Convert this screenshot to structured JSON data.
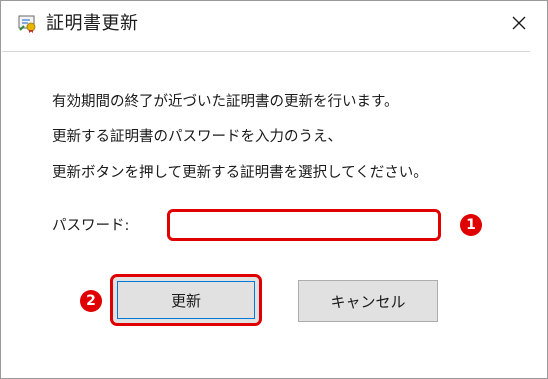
{
  "window": {
    "title": "証明書更新",
    "app_icon": "certificate-icon",
    "close_icon": "close-icon"
  },
  "message": {
    "line1": "有効期間の終了が近づいた証明書の更新を行います。",
    "line2": "更新する証明書のパスワードを入力のうえ、",
    "line3": "更新ボタンを押して更新する証明書を選択してください。"
  },
  "password": {
    "label": "パスワード:",
    "value": "",
    "placeholder": ""
  },
  "markers": {
    "m1": "1",
    "m2": "2"
  },
  "buttons": {
    "update_label": "更新",
    "cancel_label": "キャンセル"
  },
  "colors": {
    "highlight": "#e00000",
    "focus": "#0078d7",
    "button_face": "#e1e1e1"
  }
}
